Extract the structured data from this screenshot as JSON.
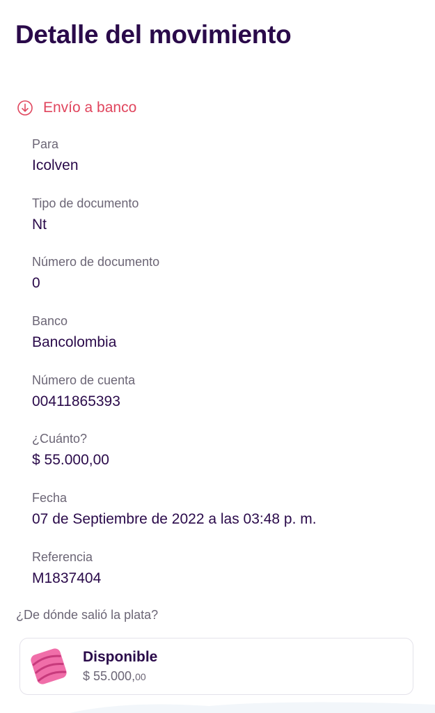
{
  "header": {
    "title": "Detalle del movimiento"
  },
  "movement": {
    "type_label": "Envío a banco",
    "type_color": "#e0455d"
  },
  "details": [
    {
      "label": "Para",
      "value": "Icolven"
    },
    {
      "label": "Tipo de documento",
      "value": "Nt"
    },
    {
      "label": "Número de documento",
      "value": "0"
    },
    {
      "label": "Banco",
      "value": "Bancolombia"
    },
    {
      "label": "Número de cuenta",
      "value": "00411865393"
    },
    {
      "label": "¿Cuánto?",
      "value": "$ 55.000,00"
    },
    {
      "label": "Fecha",
      "value": "07 de Septiembre de 2022 a las 03:48 p. m."
    },
    {
      "label": "Referencia",
      "value": "M1837404"
    }
  ],
  "source": {
    "question": "¿De dónde salió la plata?",
    "pocket_name": "Disponible",
    "amount_main": "$ 55.000,",
    "amount_cents": "00",
    "icon": "pink-pocket-icon"
  },
  "colors": {
    "primary_text": "#2a0a4a",
    "accent": "#e0455d",
    "secondary_text": "#6b6575"
  }
}
